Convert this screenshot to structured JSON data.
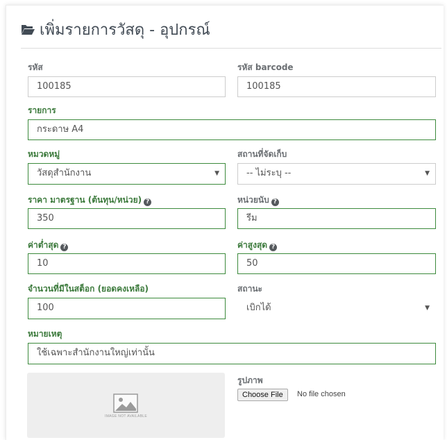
{
  "panel": {
    "title": "เพิ่มรายการวัสดุ - อุปกรณ์",
    "title_icon": "folder-open-icon"
  },
  "form": {
    "code": {
      "label": "รหัส",
      "value": "100185"
    },
    "barcode": {
      "label": "รหัส barcode",
      "value": "100185"
    },
    "item_name": {
      "label": "รายการ",
      "value": "กระดาษ A4"
    },
    "category": {
      "label": "หมวดหมู่",
      "selected": "วัสดุสำนักงาน"
    },
    "storage_location": {
      "label": "สถานที่จัดเก็บ",
      "selected": "-- ไม่ระบุ --"
    },
    "standard_price": {
      "label": "ราคา มาตรฐาน (ต้นทุน/หน่วย)",
      "value": "350"
    },
    "unit": {
      "label": "หน่วยนับ",
      "value": "รีม"
    },
    "min_qty": {
      "label": "ค่าต่ำสุด",
      "value": "10"
    },
    "max_qty": {
      "label": "ค่าสูงสุด",
      "value": "50"
    },
    "stock_qty": {
      "label": "จำนวนที่มีในสต็อก (ยอดคงเหลือ)",
      "value": "100"
    },
    "status": {
      "label": "สถานะ",
      "selected": "เบิกได้"
    },
    "remark": {
      "label": "หมายเหตุ",
      "value": "ใช้เฉพาะสำนักงานใหญ่เท่านั้น"
    },
    "image": {
      "label": "รูปภาพ",
      "placeholder_text": "IMAGE NOT AVAILABLE",
      "file_button_label": "Choose File",
      "file_status": "No file chosen"
    }
  },
  "colors": {
    "valid_green": "#3c7a3c",
    "label_grey": "#6b6f73",
    "title_text": "#424b55"
  }
}
